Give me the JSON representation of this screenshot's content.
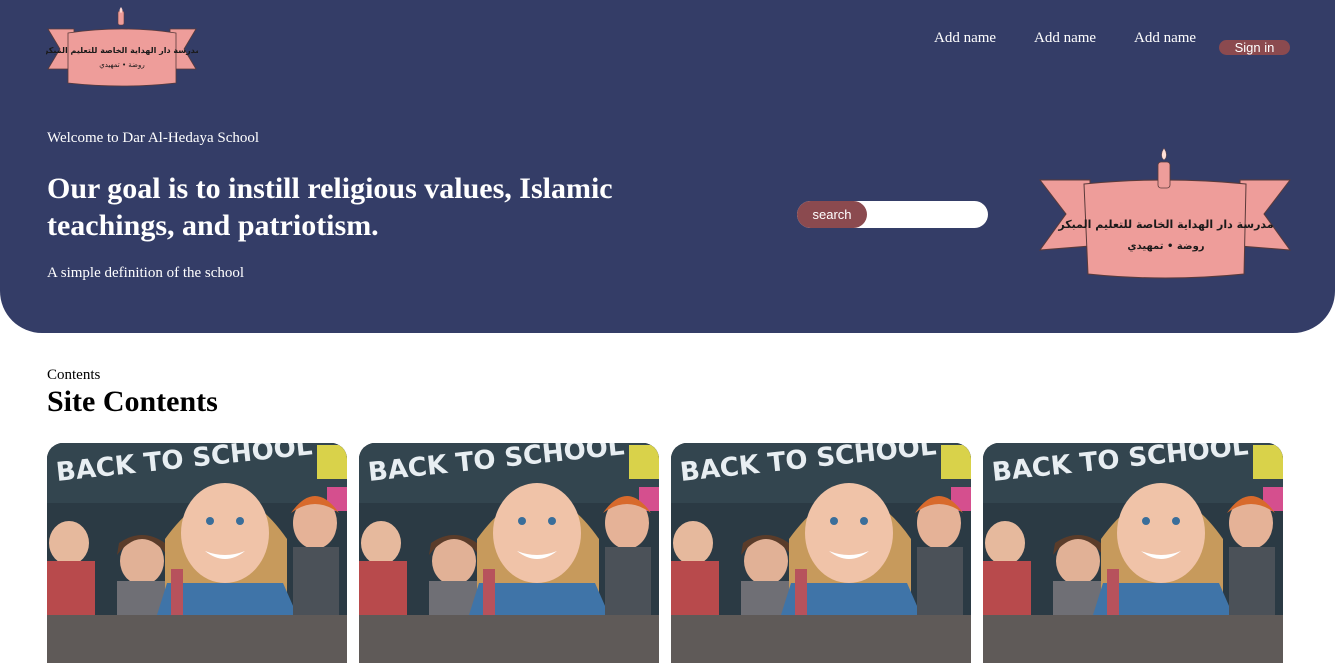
{
  "header": {
    "logo_text_line1": "مدرسة دار الهداية الخاصة للتعليم المبكر",
    "logo_text_line2": "روضة • تمهيدي",
    "nav": [
      "Add name",
      "Add name",
      "Add name"
    ],
    "signin_label": "Sign in"
  },
  "hero": {
    "welcome": "Welcome to Dar Al-Hedaya School",
    "headline": "Our goal is to instill religious values, Islamic teachings, and patriotism.",
    "definition": "A simple definition of the school",
    "search_label": "search",
    "search_placeholder": ""
  },
  "contents": {
    "label": "Contents",
    "title": "Site Contents",
    "cards": [
      {
        "image_text": "BACK TO SCHOOL"
      },
      {
        "image_text": "BACK TO SCHOOL"
      },
      {
        "image_text": "BACK TO SCHOOL"
      },
      {
        "image_text": "BACK TO SCHOOL"
      }
    ]
  },
  "colors": {
    "hero_bg": "#343d67",
    "accent": "#8b4a4f",
    "logo_ribbon": "#ee9d9a",
    "card_footer": "#5f5a58"
  }
}
